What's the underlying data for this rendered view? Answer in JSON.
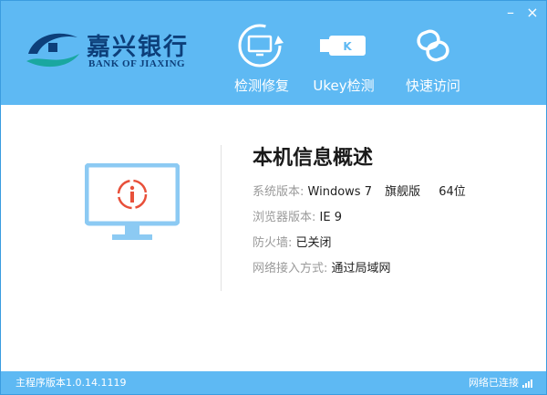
{
  "window": {
    "minimize_glyph": "–",
    "close_glyph": "×"
  },
  "logo": {
    "cn": "嘉兴银行",
    "en": "BANK OF JIAXING"
  },
  "toolbar": {
    "repair_label": "检测修复",
    "ukey_label": "Ukey检测",
    "ukey_key_letter": "K",
    "visit_label": "快速访问"
  },
  "info": {
    "title": "本机信息概述",
    "os_label": "系统版本:",
    "os_value": "Windows 7",
    "os_edition": "旗舰版",
    "os_bits": "64位",
    "browser_label": "浏览器版本:",
    "browser_value": "IE 9",
    "firewall_label": "防火墙:",
    "firewall_value": "已关闭",
    "network_label": "网络接入方式:",
    "network_value": "通过局域网"
  },
  "statusbar": {
    "version_text": "主程序版本1.0.14.1119",
    "network_status": "网络已连接"
  },
  "colors": {
    "header_bg": "#5eb9f3",
    "monitor": "#8ccaf3",
    "alert_red": "#e8503a",
    "logo_navy": "#0d3f7a",
    "logo_teal": "#1aa7a0"
  },
  "icons": {
    "repair": "monitor-refresh-icon",
    "ukey": "usb-key-icon",
    "visit": "link-chain-icon",
    "info_monitor": "monitor-alert-icon",
    "network": "signal-bars-icon"
  }
}
